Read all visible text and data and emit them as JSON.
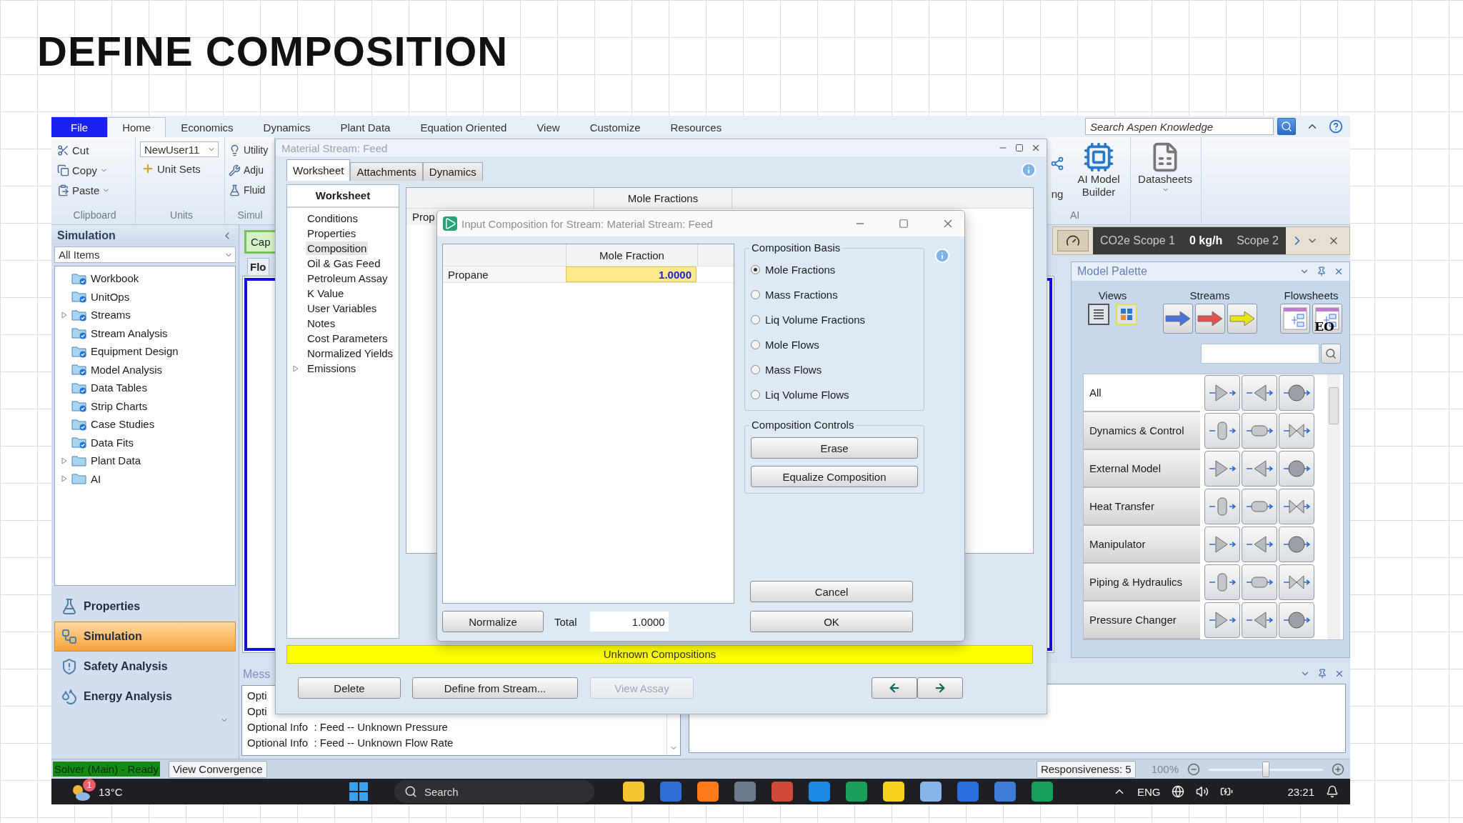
{
  "heading": "DEFINE COMPOSITION",
  "ribbon": {
    "tabs": [
      {
        "label": "File",
        "kind": "file",
        "selected": false
      },
      {
        "label": "Home",
        "kind": "tab",
        "selected": true
      },
      {
        "label": "Economics",
        "kind": "tab",
        "selected": false
      },
      {
        "label": "Dynamics",
        "kind": "tab",
        "selected": false
      },
      {
        "label": "Plant Data",
        "kind": "tab",
        "selected": false
      },
      {
        "label": "Equation Oriented",
        "kind": "tab",
        "selected": false
      },
      {
        "label": "View",
        "kind": "tab",
        "selected": false
      },
      {
        "label": "Customize",
        "kind": "tab",
        "selected": false
      },
      {
        "label": "Resources",
        "kind": "tab",
        "selected": false
      }
    ],
    "search": {
      "placeholder": "Search Aspen Knowledge"
    },
    "groups": [
      {
        "kind": "small",
        "label": "Clipboard",
        "items": [
          {
            "label": "Cut",
            "dropdown": false
          },
          {
            "label": "Copy",
            "dropdown": true
          },
          {
            "label": "Paste",
            "dropdown": true
          }
        ]
      },
      {
        "kind": "units",
        "label": "Units",
        "select": "NewUser11",
        "items": [
          {
            "label": "Unit Sets",
            "dropdown": false
          }
        ]
      },
      {
        "kind": "small",
        "label": "Simul",
        "items": [
          {
            "label": "Utility",
            "dropdown": false
          },
          {
            "label": "Adju",
            "dropdown": false
          },
          {
            "label": "Fluid",
            "dropdown": false
          }
        ]
      },
      {
        "kind": "large",
        "label": "AI",
        "items": [
          {
            "label": "ng",
            "dropdown": false
          },
          {
            "label": "AI Model Builder",
            "dropdown": false
          }
        ]
      },
      {
        "kind": "large",
        "items": [
          {
            "label": "Datasheets",
            "dropdown": true
          }
        ]
      }
    ]
  },
  "nav": {
    "title": "Simulation",
    "filter": "All Items",
    "tree": [
      {
        "label": "Workbook",
        "kind": "view"
      },
      {
        "label": "UnitOps",
        "kind": "view"
      },
      {
        "label": "Streams",
        "kind": "view",
        "expanded": false
      },
      {
        "label": "Stream Analysis",
        "kind": "view"
      },
      {
        "label": "Equipment Design",
        "kind": "view"
      },
      {
        "label": "Model Analysis",
        "kind": "view"
      },
      {
        "label": "Data Tables",
        "kind": "view"
      },
      {
        "label": "Strip Charts",
        "kind": "view"
      },
      {
        "label": "Case Studies",
        "kind": "view"
      },
      {
        "label": "Data Fits",
        "kind": "view"
      },
      {
        "label": "Plant Data",
        "kind": "folder",
        "expanded": false
      },
      {
        "label": "AI",
        "kind": "folder",
        "expanded": false
      }
    ],
    "sections": [
      {
        "label": "Properties",
        "selected": false
      },
      {
        "label": "Simulation",
        "selected": true
      },
      {
        "label": "Safety Analysis",
        "selected": false
      },
      {
        "label": "Energy Analysis",
        "selected": false
      }
    ]
  },
  "flowsheet": {
    "button": "Cap",
    "tab": "Flo"
  },
  "co2": {
    "label": "CO2e Scope 1",
    "value": "0 kg/h",
    "next": "Scope 2"
  },
  "palette": {
    "title": "Model Palette",
    "views": {
      "label": "Views",
      "items": [
        {
          "kind": "list",
          "selected": false
        },
        {
          "kind": "grid",
          "selected": true
        }
      ]
    },
    "streams": {
      "label": "Streams",
      "items": [
        {
          "color": "#4a72d6"
        },
        {
          "color": "#e0524f"
        },
        {
          "color": "#e6e619"
        }
      ]
    },
    "flowsheets": {
      "label": "Flowsheets",
      "items": [
        {
          "kind": "standard"
        },
        {
          "kind": "equation-oriented",
          "badge": "EO"
        }
      ]
    },
    "categories": [
      {
        "label": "All",
        "selected": true
      },
      {
        "label": "Dynamics & Control",
        "selected": false
      },
      {
        "label": "External Model",
        "selected": false
      },
      {
        "label": "Heat Transfer",
        "selected": false
      },
      {
        "label": "Manipulator",
        "selected": false
      },
      {
        "label": "Piping & Hydraulics",
        "selected": false
      },
      {
        "label": "Pressure Changer",
        "selected": false
      }
    ]
  },
  "messages": {
    "title": "Mess",
    "lines": [
      "Opti",
      "Opti",
      "Optional Info  : Feed -- Unknown Pressure",
      "Optional Info  : Feed -- Unknown Flow Rate"
    ]
  },
  "status": {
    "solver": "Solver (Main) - Ready",
    "convergence": "View Convergence",
    "responsiveness": "Responsiveness: 5",
    "zoom": "100%",
    "zoom_slider": {
      "level": 0.5
    }
  },
  "taskbar": {
    "weather_badge": "1",
    "temperature": "13°C",
    "search": {
      "placeholder": "Search"
    },
    "language": "ENG",
    "time": "23:21"
  },
  "stream_window": {
    "title": "Material Stream: Feed",
    "tabs": [
      {
        "label": "Worksheet",
        "selected": true
      },
      {
        "label": "Attachments",
        "selected": false
      },
      {
        "label": "Dynamics",
        "selected": false
      }
    ],
    "page_list": {
      "title": "Worksheet",
      "items": [
        {
          "label": "Conditions",
          "selected": false
        },
        {
          "label": "Properties",
          "selected": false
        },
        {
          "label": "Composition",
          "selected": true
        },
        {
          "label": "Oil & Gas Feed",
          "selected": false
        },
        {
          "label": "Petroleum Assay",
          "selected": false
        },
        {
          "label": "K Value",
          "selected": false
        },
        {
          "label": "User Variables",
          "selected": false
        },
        {
          "label": "Notes",
          "selected": false
        },
        {
          "label": "Cost Parameters",
          "selected": false
        },
        {
          "label": "Normalized Yields",
          "selected": false
        },
        {
          "label": "Emissions",
          "selected": false,
          "expanded": false
        }
      ]
    },
    "table": {
      "column": "Mole Fractions",
      "row": "Prop"
    },
    "status": "Unknown Compositions",
    "buttons": [
      {
        "label": "Delete",
        "disabled": false
      },
      {
        "label": "Define from Stream...",
        "disabled": false
      },
      {
        "label": "View Assay",
        "disabled": true
      }
    ]
  },
  "dialog": {
    "title": "Input Composition for Stream: Material Stream: Feed",
    "grid": {
      "column": "Mole Fraction",
      "rows": [
        {
          "name": "Propane",
          "value": "1.0000",
          "selected": true
        }
      ]
    },
    "basis": {
      "title": "Composition Basis",
      "options": [
        {
          "label": "Mole Fractions",
          "selected": true
        },
        {
          "label": "Mass Fractions",
          "selected": false
        },
        {
          "label": "Liq Volume Fractions",
          "selected": false
        },
        {
          "label": "Mole Flows",
          "selected": false
        },
        {
          "label": "Mass Flows",
          "selected": false
        },
        {
          "label": "Liq Volume Flows",
          "selected": false
        }
      ]
    },
    "controls": {
      "title": "Composition Controls",
      "buttons": [
        "Erase",
        "Equalize Composition"
      ]
    },
    "normalize": "Normalize",
    "total": {
      "label": "Total",
      "value": "1.0000"
    },
    "actions": [
      "Cancel",
      "OK"
    ]
  }
}
